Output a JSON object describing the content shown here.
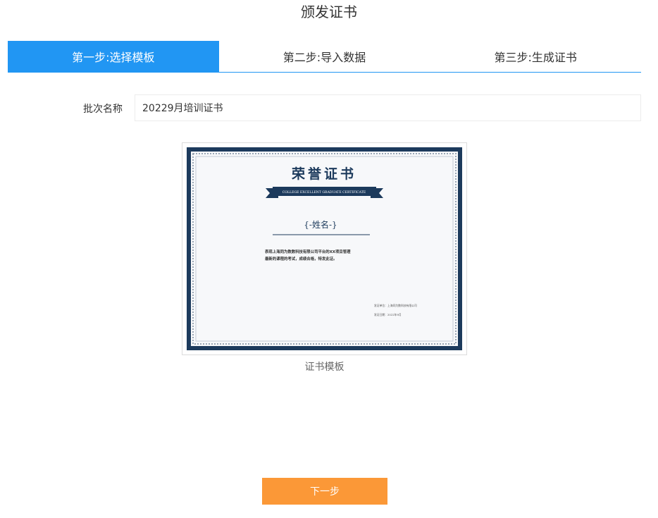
{
  "page": {
    "title": "颁发证书"
  },
  "steps": [
    {
      "label": "第一步:选择模板",
      "active": true
    },
    {
      "label": "第二步:导入数据",
      "active": false
    },
    {
      "label": "第三步:生成证书",
      "active": false
    }
  ],
  "batch": {
    "label": "批次名称",
    "value": "20229月培训证书"
  },
  "template": {
    "caption": "证书模板",
    "cert_title": "荣誉证书",
    "ribbon_text": "COLLEGE EXCELLENT GRADUATE CERTIFICATE",
    "name_placeholder": "{-姓名-}",
    "body_line1": "表现上海同为数数科技有限公司平台的XX项目管理",
    "body_line2": "最新的课程的考试，成绩合格，特发此证。",
    "footer_unit": "发证单位：上海同为数科技有限公司",
    "footer_date": "发证日期：2022年9月",
    "colors": {
      "frame": "#1c3a5c",
      "paper": "#f7f8fa"
    }
  },
  "actions": {
    "next_label": "下一步"
  },
  "theme": {
    "accent": "#2196f3",
    "button": "#fb9837"
  }
}
